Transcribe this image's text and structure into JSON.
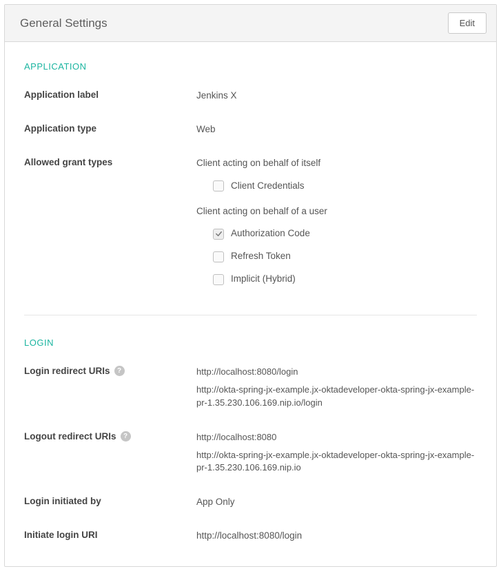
{
  "colors": {
    "accent": "#1bb5a0"
  },
  "header": {
    "title": "General Settings",
    "edit_label": "Edit"
  },
  "sections": {
    "application": {
      "title": "APPLICATION",
      "fields": {
        "label_label": "Application label",
        "label_value": "Jenkins X",
        "type_label": "Application type",
        "type_value": "Web",
        "grant_label": "Allowed grant types",
        "grant_self_heading": "Client acting on behalf of itself",
        "grant_user_heading": "Client acting on behalf of a user",
        "grant_types": {
          "client_credentials": {
            "label": "Client Credentials",
            "checked": false
          },
          "authorization_code": {
            "label": "Authorization Code",
            "checked": true
          },
          "refresh_token": {
            "label": "Refresh Token",
            "checked": false
          },
          "implicit": {
            "label": "Implicit (Hybrid)",
            "checked": false
          }
        }
      }
    },
    "login": {
      "title": "LOGIN",
      "login_redirect_label": "Login redirect URIs",
      "login_redirect_uris": [
        "http://localhost:8080/login",
        "http://okta-spring-jx-example.jx-oktadeveloper-okta-spring-jx-example-pr-1.35.230.106.169.nip.io/login"
      ],
      "logout_redirect_label": "Logout redirect URIs",
      "logout_redirect_uris": [
        "http://localhost:8080",
        "http://okta-spring-jx-example.jx-oktadeveloper-okta-spring-jx-example-pr-1.35.230.106.169.nip.io"
      ],
      "login_initiated_label": "Login initiated by",
      "login_initiated_value": "App Only",
      "initiate_login_uri_label": "Initiate login URI",
      "initiate_login_uri_value": "http://localhost:8080/login"
    }
  }
}
